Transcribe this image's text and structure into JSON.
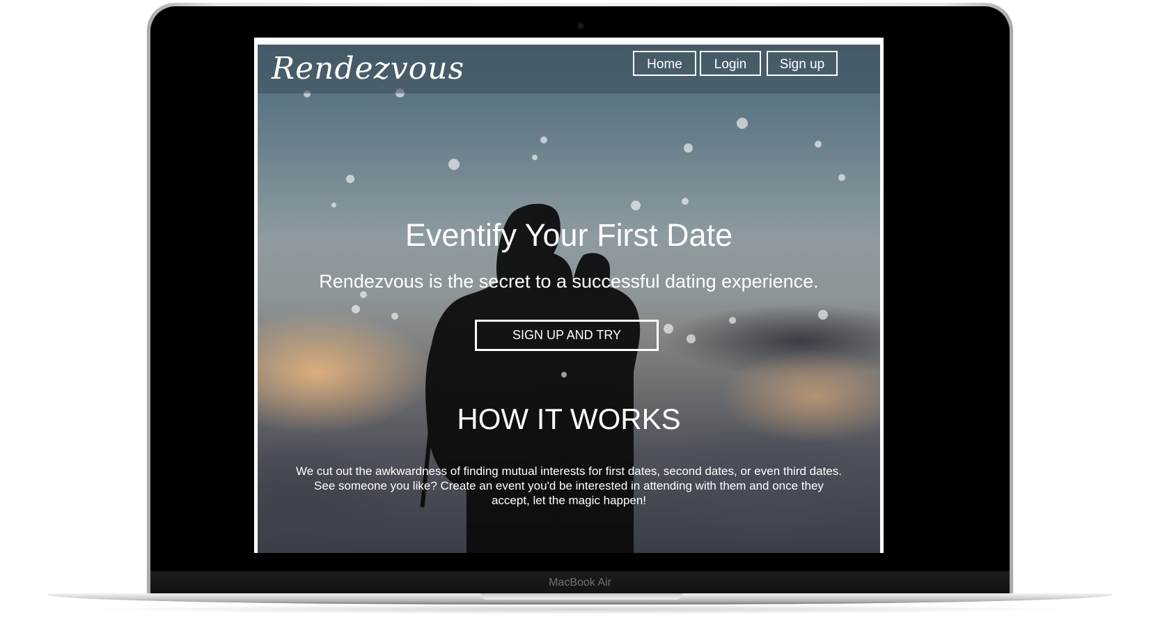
{
  "device": {
    "label": "MacBook Air"
  },
  "site": {
    "logo": "Rendezvous",
    "nav": [
      {
        "label": "Home"
      },
      {
        "label": "Login"
      },
      {
        "label": "Sign up"
      }
    ],
    "hero": {
      "title": "Eventify Your First Date",
      "subtitle": "Rendezvous is the secret to a successful dating experience.",
      "cta_label": "SIGN UP AND TRY"
    },
    "how_it_works": {
      "title": "HOW IT WORKS",
      "body": "We cut out the awkwardness of finding mutual interests for first dates, second dates, or even third dates. See someone you like? Create an event you'd be interested in attending with them and once they accept, let the magic happen!"
    }
  },
  "colors": {
    "bezel": "#000000",
    "text": "#ffffff",
    "sky_top": "#4d6878",
    "sunset_glow": "#eeb87e"
  }
}
